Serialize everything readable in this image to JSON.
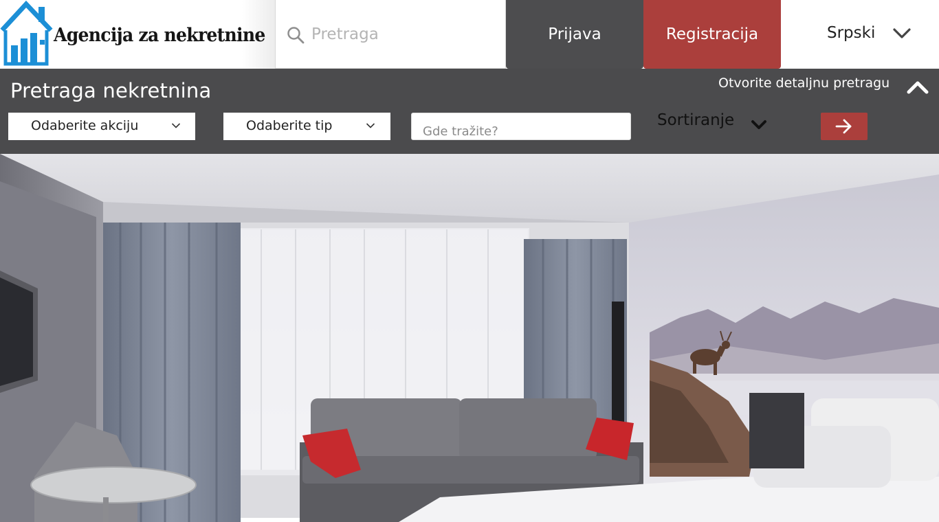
{
  "header": {
    "logo_text": "Agencija za nekretnine",
    "search_placeholder": "Pretraga",
    "login_label": "Prijava",
    "register_label": "Registracija",
    "language_label": "Srpski",
    "icons": [
      "house-logo-icon",
      "search-icon",
      "chevron-down-icon"
    ]
  },
  "search_panel": {
    "title": "Pretraga nekretnina",
    "advanced_label": "Otvorite detaljnu pretragu",
    "action_select": {
      "selected": "Odaberite akciju"
    },
    "type_select": {
      "selected": "Odaberite tip"
    },
    "location_placeholder": "Gde tražite?",
    "sort_label": "Sortiranje",
    "icons": [
      "chevron-up-icon",
      "chevron-down-icon",
      "arrow-right-icon"
    ]
  },
  "colors": {
    "panel_bg": "#4b4b4d",
    "login_bg": "#4d4d4f",
    "accent": "#ab3f3c",
    "logo_blue": "#1c8fd6"
  }
}
